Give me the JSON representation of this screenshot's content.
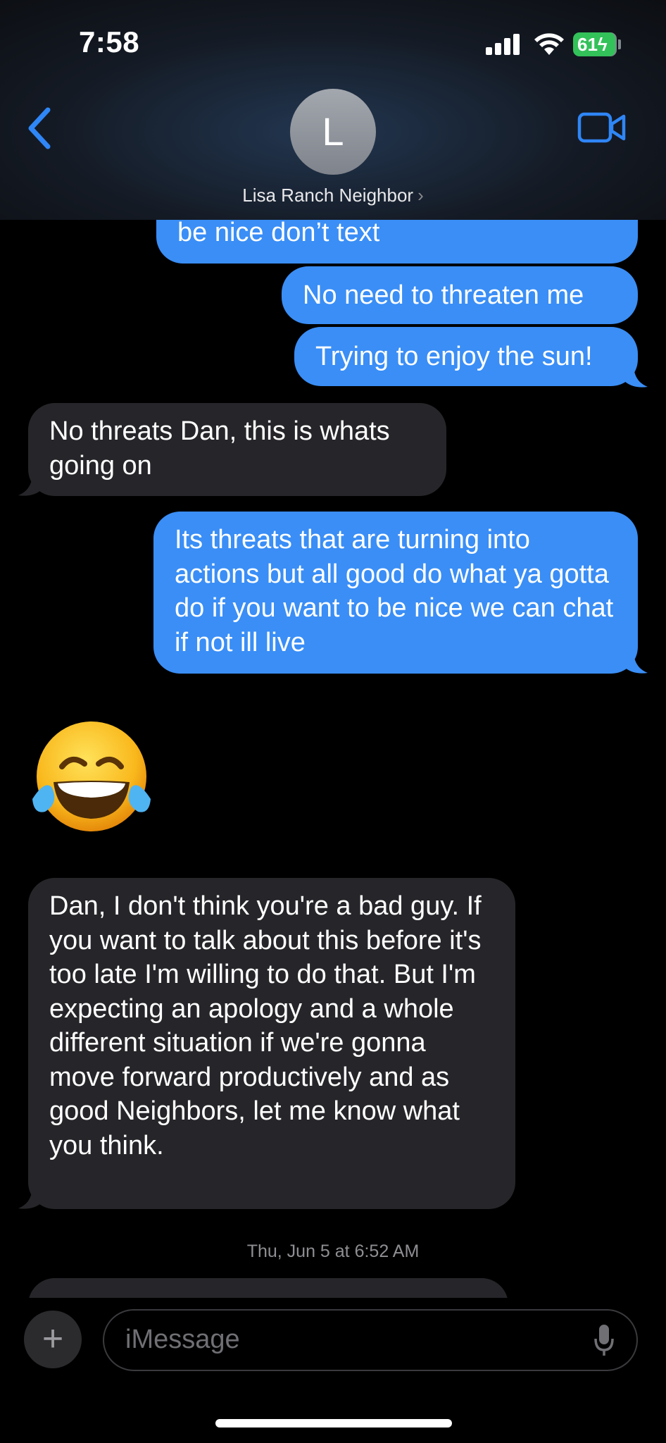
{
  "status_bar": {
    "time": "7:58",
    "battery": "61"
  },
  "header": {
    "avatar_initial": "L",
    "contact_name": "Lisa Ranch Neighbor",
    "chevron": "›"
  },
  "messages": [
    {
      "type": "sent",
      "text": "be nice don’t text"
    },
    {
      "type": "sent",
      "text": "No need to threaten me"
    },
    {
      "type": "sent",
      "text": "Trying to enjoy the sun!"
    },
    {
      "type": "received",
      "text": "No threats Dan, this is whats going on"
    },
    {
      "type": "sent",
      "text": "Its threats that are turning into actions but all good do what ya gotta do if you want to be nice we can chat if not ill live"
    },
    {
      "type": "received_emoji",
      "text": "😂"
    },
    {
      "type": "received",
      "text": "Dan, I don't think you're a bad guy. If you want to talk about this before it's too late I'm willing to do that. But I'm expecting an apology and a whole different situation if we're gonna move forward productively and as good Neighbors, let me know what you think."
    }
  ],
  "timestamp": "Thu, Jun 5 at 6:52 AM",
  "composer": {
    "placeholder": "iMessage",
    "plus": "+"
  },
  "colors": {
    "sent": "#3a8ef6",
    "received": "#26262a",
    "accent": "#2f86f6"
  },
  "icons": [
    "back-chevron-icon",
    "video-camera-icon",
    "signal-icon",
    "wifi-icon",
    "battery-icon",
    "plus-icon",
    "microphone-icon"
  ]
}
